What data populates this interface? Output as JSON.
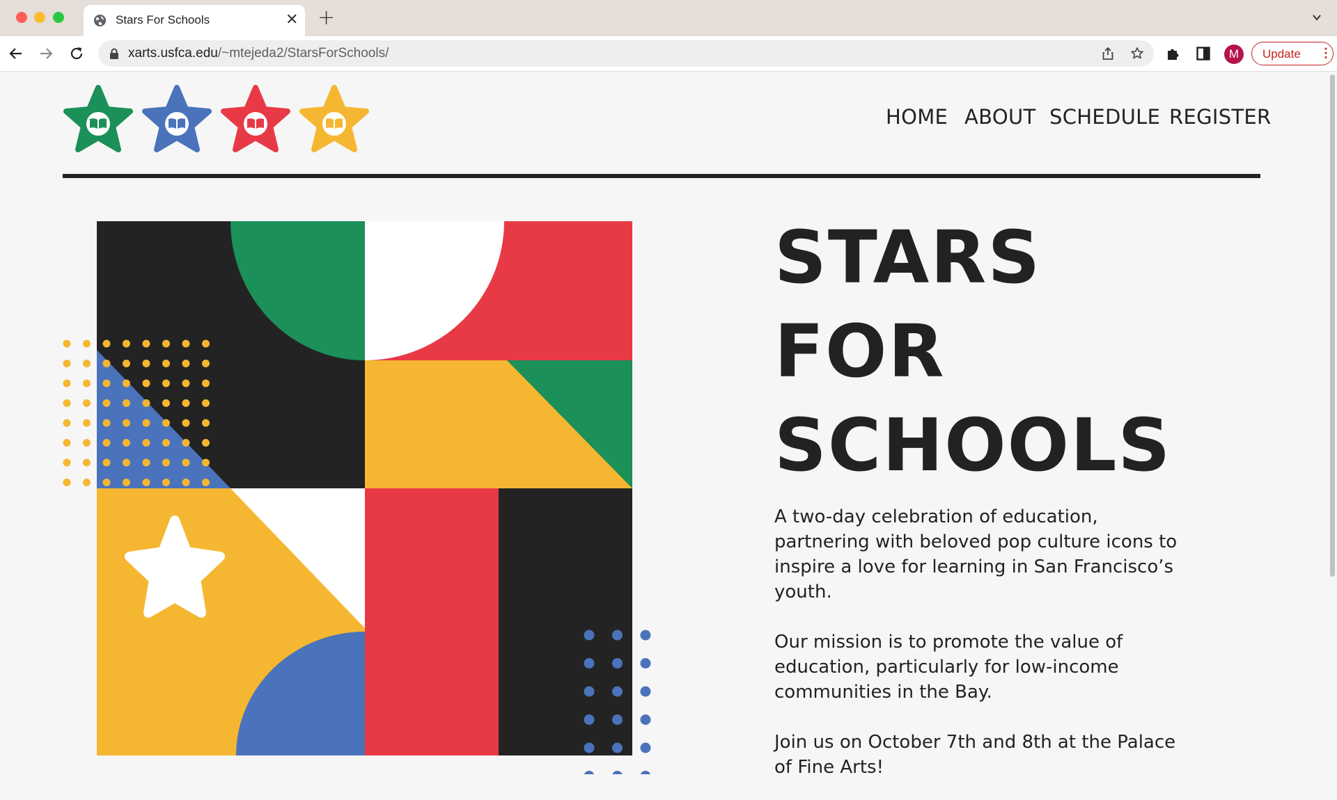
{
  "browser": {
    "tab_title": "Stars For Schools",
    "url_host": "xarts.usfca.edu",
    "url_path": "/~mtejeda2/StarsForSchools/",
    "profile_initial": "M",
    "update_label": "Update",
    "new_tab_icon": "+",
    "close_icon": "✕"
  },
  "site": {
    "nav": [
      "HOME",
      "ABOUT",
      "SCHEDULE",
      "REGISTER"
    ],
    "logo_star_colors": [
      "#1b9058",
      "#4a73bb",
      "#e83a46",
      "#f5b731"
    ],
    "title_lines": [
      "STARS",
      "FOR",
      "SCHOOLS"
    ],
    "paragraphs": [
      "A two-day celebration of education, partnering with beloved pop culture icons to inspire a love for learning in San Francisco’s youth.",
      "Our mission is to promote the value of education, particularly for low-income communities in the Bay.",
      "Join us on October 7th and 8th at the Palace of Fine Arts!"
    ]
  },
  "colors": {
    "green": "#1b9058",
    "blue": "#4a73bb",
    "red": "#e83a46",
    "yellow": "#f5b731",
    "black": "#232323",
    "white": "#ffffff"
  }
}
